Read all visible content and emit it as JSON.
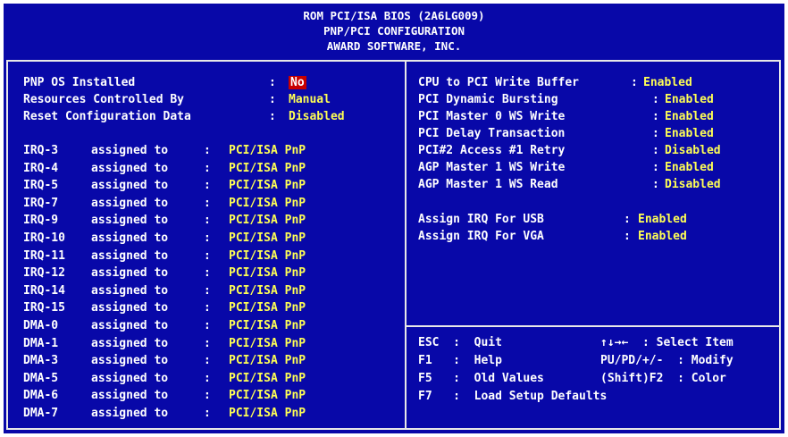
{
  "header": {
    "line1": "ROM PCI/ISA BIOS (2A6LG009)",
    "line2": "PNP/PCI CONFIGURATION",
    "line3": "AWARD SOFTWARE, INC."
  },
  "left_top": [
    {
      "label": "PNP OS Installed",
      "sep": ":",
      "value": "No",
      "selected": true
    },
    {
      "label": "Resources Controlled By",
      "sep": ":",
      "value": "Manual"
    },
    {
      "label": "Reset Configuration Data",
      "sep": ":",
      "value": "Disabled"
    }
  ],
  "assignments": [
    {
      "label": "IRQ-3",
      "mid": "assigned to",
      "sep": ":",
      "value": "PCI/ISA PnP"
    },
    {
      "label": "IRQ-4",
      "mid": "assigned to",
      "sep": ":",
      "value": "PCI/ISA PnP"
    },
    {
      "label": "IRQ-5",
      "mid": "assigned to",
      "sep": ":",
      "value": "PCI/ISA PnP"
    },
    {
      "label": "IRQ-7",
      "mid": "assigned to",
      "sep": ":",
      "value": "PCI/ISA PnP"
    },
    {
      "label": "IRQ-9",
      "mid": "assigned to",
      "sep": ":",
      "value": "PCI/ISA PnP"
    },
    {
      "label": "IRQ-10",
      "mid": "assigned to",
      "sep": ":",
      "value": "PCI/ISA PnP"
    },
    {
      "label": "IRQ-11",
      "mid": "assigned to",
      "sep": ":",
      "value": "PCI/ISA PnP"
    },
    {
      "label": "IRQ-12",
      "mid": "assigned to",
      "sep": ":",
      "value": "PCI/ISA PnP"
    },
    {
      "label": "IRQ-14",
      "mid": "assigned to",
      "sep": ":",
      "value": "PCI/ISA PnP"
    },
    {
      "label": "IRQ-15",
      "mid": "assigned to",
      "sep": ":",
      "value": "PCI/ISA PnP"
    },
    {
      "label": "DMA-0",
      "mid": "assigned to",
      "sep": ":",
      "value": "PCI/ISA PnP"
    },
    {
      "label": "DMA-1",
      "mid": "assigned to",
      "sep": ":",
      "value": "PCI/ISA PnP"
    },
    {
      "label": "DMA-3",
      "mid": "assigned to",
      "sep": ":",
      "value": "PCI/ISA PnP"
    },
    {
      "label": "DMA-5",
      "mid": "assigned to",
      "sep": ":",
      "value": "PCI/ISA PnP"
    },
    {
      "label": "DMA-6",
      "mid": "assigned to",
      "sep": ":",
      "value": "PCI/ISA PnP"
    },
    {
      "label": "DMA-7",
      "mid": "assigned to",
      "sep": ":",
      "value": "PCI/ISA PnP"
    }
  ],
  "right_top": [
    {
      "label": "CPU to PCI Write Buffer",
      "sep": ":",
      "value": "Enabled"
    },
    {
      "label": "PCI Dynamic Bursting",
      "sep": ":",
      "value": "Enabled"
    },
    {
      "label": "PCI Master 0 WS Write",
      "sep": ":",
      "value": "Enabled"
    },
    {
      "label": "PCI Delay Transaction",
      "sep": ":",
      "value": "Enabled"
    },
    {
      "label": "PCI#2 Access #1 Retry",
      "sep": ":",
      "value": "Disabled"
    },
    {
      "label": "AGP Master 1 WS Write",
      "sep": ":",
      "value": "Enabled"
    },
    {
      "label": "AGP Master 1 WS Read",
      "sep": ":",
      "value": "Disabled"
    }
  ],
  "right_mid": [
    {
      "label": "Assign IRQ For USB",
      "sep": ":",
      "value": "Enabled"
    },
    {
      "label": "Assign IRQ For VGA",
      "sep": ":",
      "value": "Enabled"
    }
  ],
  "help": [
    {
      "left": "ESC  :  Quit",
      "right": "↑↓→←  : Select Item"
    },
    {
      "left": "F1   :  Help",
      "right": "PU/PD/+/-  : Modify"
    },
    {
      "left": "F5   :  Old Values",
      "right": "(Shift)F2  : Color"
    },
    {
      "left": "F7   :  Load Setup Defaults",
      "right": ""
    }
  ]
}
